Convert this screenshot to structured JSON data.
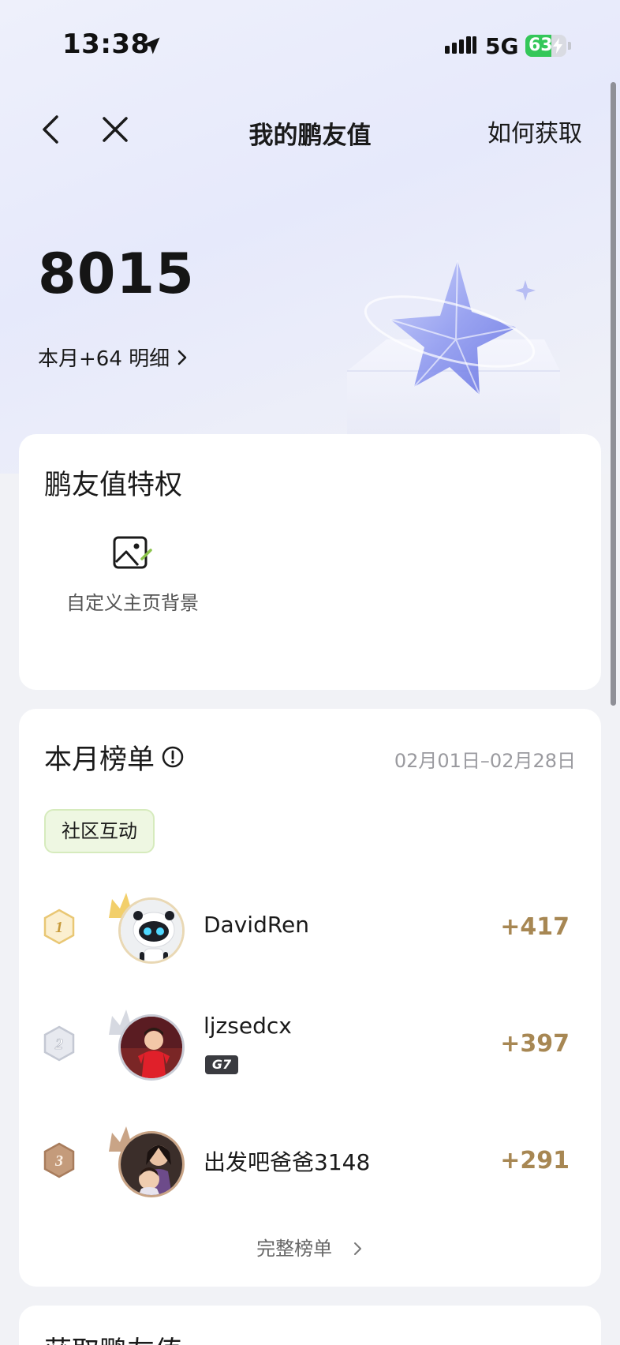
{
  "status_bar": {
    "time": "13:38",
    "network": "5G",
    "battery_level": "63",
    "battery_fraction": 0.63,
    "battery_color": "#34c759"
  },
  "nav": {
    "back_icon": "chevron-left-icon",
    "close_icon": "close-icon",
    "title": "我的鹏友值",
    "right_link": "如何获取"
  },
  "hero": {
    "points": "8015",
    "month_detail": "本月+64 明细"
  },
  "privileges": {
    "title": "鹏友值特权",
    "items": [
      {
        "icon": "image-edit-icon",
        "label": "自定义主页背景"
      }
    ]
  },
  "ranking": {
    "title": "本月榜单",
    "date_range": "02月01日–02月28日",
    "active_tab": "社区互动",
    "rows": [
      {
        "rank": "1",
        "name": "DavidRen",
        "score": "+417",
        "level": "",
        "rank_color": "#e9c774"
      },
      {
        "rank": "2",
        "name": "ljzsedcx",
        "score": "+397",
        "level": "G7",
        "rank_color": "#c4c8d3"
      },
      {
        "rank": "3",
        "name": "出发吧爸爸3148",
        "score": "+291",
        "level": "",
        "rank_color": "#b48a6a"
      }
    ],
    "full_list_label": "完整榜单"
  },
  "earn": {
    "title": "获取鹏友值"
  },
  "colors": {
    "accent_gold": "#a78753",
    "tab_bg": "#eef7e2",
    "tab_border": "#d6ebbd"
  }
}
